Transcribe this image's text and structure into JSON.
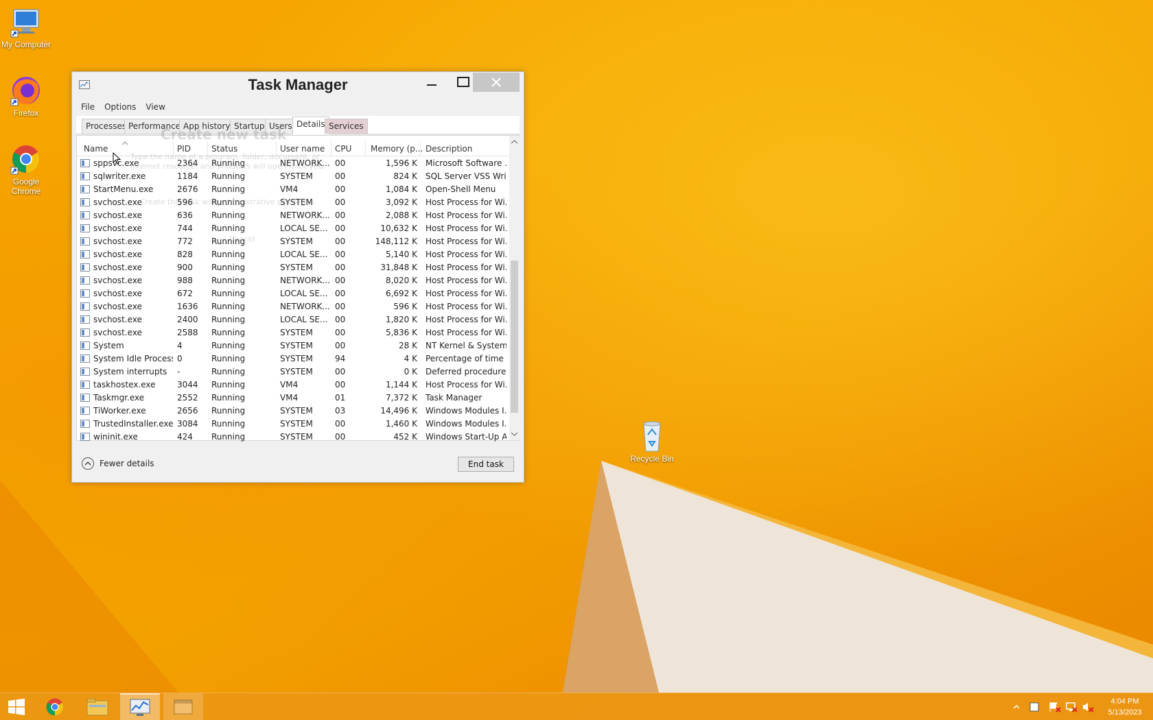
{
  "desktop": {
    "icons": [
      {
        "label": "My Computer"
      },
      {
        "label": "Firefox"
      },
      {
        "label": "Google Chrome"
      },
      {
        "label": "Recycle Bin"
      }
    ]
  },
  "window": {
    "title": "Task Manager",
    "menu": [
      "File",
      "Options",
      "View"
    ],
    "tabs": [
      "Processes",
      "Performance",
      "App history",
      "Startup",
      "Users",
      "Details",
      "Services"
    ],
    "active_tab": "Details",
    "columns": [
      "Name",
      "PID",
      "Status",
      "User name",
      "CPU",
      "Memory (p...",
      "Description"
    ],
    "rows": [
      {
        "name": "sppsvc.exe",
        "pid": "2364",
        "status": "Running",
        "user": "NETWORK...",
        "cpu": "00",
        "mem": "1,596 K",
        "desc": "Microsoft Software ..."
      },
      {
        "name": "sqlwriter.exe",
        "pid": "1184",
        "status": "Running",
        "user": "SYSTEM",
        "cpu": "00",
        "mem": "824 K",
        "desc": "SQL Server VSS Writ..."
      },
      {
        "name": "StartMenu.exe",
        "pid": "2676",
        "status": "Running",
        "user": "VM4",
        "cpu": "00",
        "mem": "1,084 K",
        "desc": "Open-Shell Menu"
      },
      {
        "name": "svchost.exe",
        "pid": "596",
        "status": "Running",
        "user": "SYSTEM",
        "cpu": "00",
        "mem": "3,092 K",
        "desc": "Host Process for Wi..."
      },
      {
        "name": "svchost.exe",
        "pid": "636",
        "status": "Running",
        "user": "NETWORK...",
        "cpu": "00",
        "mem": "2,088 K",
        "desc": "Host Process for Wi..."
      },
      {
        "name": "svchost.exe",
        "pid": "744",
        "status": "Running",
        "user": "LOCAL SE...",
        "cpu": "00",
        "mem": "10,632 K",
        "desc": "Host Process for Wi..."
      },
      {
        "name": "svchost.exe",
        "pid": "772",
        "status": "Running",
        "user": "SYSTEM",
        "cpu": "00",
        "mem": "148,112 K",
        "desc": "Host Process for Wi..."
      },
      {
        "name": "svchost.exe",
        "pid": "828",
        "status": "Running",
        "user": "LOCAL SE...",
        "cpu": "00",
        "mem": "5,140 K",
        "desc": "Host Process for Wi..."
      },
      {
        "name": "svchost.exe",
        "pid": "900",
        "status": "Running",
        "user": "SYSTEM",
        "cpu": "00",
        "mem": "31,848 K",
        "desc": "Host Process for Wi..."
      },
      {
        "name": "svchost.exe",
        "pid": "988",
        "status": "Running",
        "user": "NETWORK...",
        "cpu": "00",
        "mem": "8,020 K",
        "desc": "Host Process for Wi..."
      },
      {
        "name": "svchost.exe",
        "pid": "672",
        "status": "Running",
        "user": "LOCAL SE...",
        "cpu": "00",
        "mem": "6,692 K",
        "desc": "Host Process for Wi..."
      },
      {
        "name": "svchost.exe",
        "pid": "1636",
        "status": "Running",
        "user": "NETWORK...",
        "cpu": "00",
        "mem": "596 K",
        "desc": "Host Process for Wi..."
      },
      {
        "name": "svchost.exe",
        "pid": "2400",
        "status": "Running",
        "user": "LOCAL SE...",
        "cpu": "00",
        "mem": "1,820 K",
        "desc": "Host Process for Wi..."
      },
      {
        "name": "svchost.exe",
        "pid": "2588",
        "status": "Running",
        "user": "SYSTEM",
        "cpu": "00",
        "mem": "5,836 K",
        "desc": "Host Process for Wi..."
      },
      {
        "name": "System",
        "pid": "4",
        "status": "Running",
        "user": "SYSTEM",
        "cpu": "00",
        "mem": "28 K",
        "desc": "NT Kernel & System"
      },
      {
        "name": "System Idle Process",
        "pid": "0",
        "status": "Running",
        "user": "SYSTEM",
        "cpu": "94",
        "mem": "4 K",
        "desc": "Percentage of time t..."
      },
      {
        "name": "System interrupts",
        "pid": "-",
        "status": "Running",
        "user": "SYSTEM",
        "cpu": "00",
        "mem": "0 K",
        "desc": "Deferred procedure ..."
      },
      {
        "name": "taskhostex.exe",
        "pid": "3044",
        "status": "Running",
        "user": "VM4",
        "cpu": "00",
        "mem": "1,144 K",
        "desc": "Host Process for Wi..."
      },
      {
        "name": "Taskmgr.exe",
        "pid": "2552",
        "status": "Running",
        "user": "VM4",
        "cpu": "01",
        "mem": "7,372 K",
        "desc": "Task Manager"
      },
      {
        "name": "TiWorker.exe",
        "pid": "2656",
        "status": "Running",
        "user": "SYSTEM",
        "cpu": "03",
        "mem": "14,496 K",
        "desc": "Windows Modules I..."
      },
      {
        "name": "TrustedInstaller.exe",
        "pid": "3084",
        "status": "Running",
        "user": "SYSTEM",
        "cpu": "00",
        "mem": "1,460 K",
        "desc": "Windows Modules I..."
      },
      {
        "name": "wininit.exe",
        "pid": "424",
        "status": "Running",
        "user": "SYSTEM",
        "cpu": "00",
        "mem": "452 K",
        "desc": "Windows Start-Up A..."
      }
    ],
    "fewer_details": "Fewer details",
    "end_task": "End task",
    "ghost_dialog": {
      "title": "Create new task",
      "text": "Type the name of a program, folder, document, or Internet resource, and Windows will open it for you.",
      "admin": "Create this task with administrative privileges.",
      "cancel": "Cancel"
    }
  },
  "taskbar": {
    "clock_time": "4:04 PM",
    "clock_date": "5/13/2023"
  },
  "colors": {
    "wallpaper": "#f5a700",
    "taskbar": "#eb9614"
  }
}
